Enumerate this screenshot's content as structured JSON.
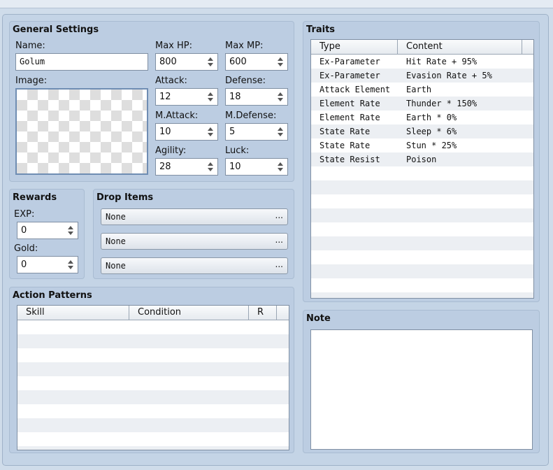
{
  "general": {
    "title": "General Settings",
    "name_label": "Name:",
    "name_value": "Golum",
    "image_label": "Image:",
    "stats": [
      {
        "label": "Max HP:",
        "value": "800"
      },
      {
        "label": "Max MP:",
        "value": "600"
      },
      {
        "label": "Attack:",
        "value": "12"
      },
      {
        "label": "Defense:",
        "value": "18"
      },
      {
        "label": "M.Attack:",
        "value": "10"
      },
      {
        "label": "M.Defense:",
        "value": "5"
      },
      {
        "label": "Agility:",
        "value": "28"
      },
      {
        "label": "Luck:",
        "value": "10"
      }
    ]
  },
  "rewards": {
    "title": "Rewards",
    "exp_label": "EXP:",
    "exp_value": "0",
    "gold_label": "Gold:",
    "gold_value": "0"
  },
  "drop_items": {
    "title": "Drop Items",
    "items": [
      "None",
      "None",
      "None"
    ],
    "button_glyph": "..."
  },
  "action_patterns": {
    "title": "Action Patterns",
    "columns": [
      "Skill",
      "Condition",
      "R"
    ]
  },
  "traits": {
    "title": "Traits",
    "columns": [
      "Type",
      "Content"
    ],
    "rows": [
      {
        "type": "Ex-Parameter",
        "content": "Hit Rate + 95%"
      },
      {
        "type": "Ex-Parameter",
        "content": "Evasion Rate + 5%"
      },
      {
        "type": "Attack Element",
        "content": "Earth"
      },
      {
        "type": "Element Rate",
        "content": "Thunder * 150%"
      },
      {
        "type": "Element Rate",
        "content": "Earth * 0%"
      },
      {
        "type": "State Rate",
        "content": "Sleep * 6%"
      },
      {
        "type": "State Rate",
        "content": "Stun * 25%"
      },
      {
        "type": "State Resist",
        "content": "Poison"
      }
    ]
  },
  "note": {
    "title": "Note",
    "value": ""
  }
}
